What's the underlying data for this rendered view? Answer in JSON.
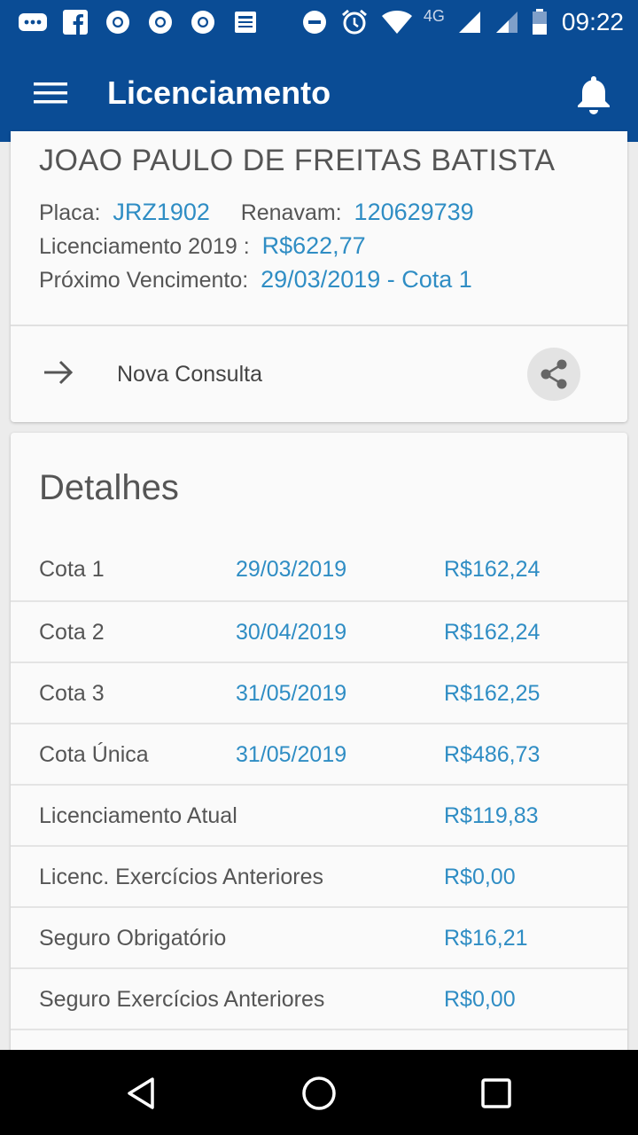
{
  "status_bar": {
    "time": "09:22",
    "network_type": "4G",
    "icons": [
      "message-icon",
      "facebook-icon",
      "chrome-icon",
      "chrome-icon",
      "chrome-icon",
      "news-icon",
      "do-not-disturb-icon",
      "alarm-icon",
      "wifi-icon",
      "signal-icon",
      "signal-icon",
      "battery-icon"
    ]
  },
  "app_bar": {
    "title": "Licenciamento",
    "menu_icon": "menu-icon",
    "notification_icon": "bell-icon"
  },
  "vehicle": {
    "owner": "JOAO PAULO DE FREITAS BATISTA",
    "placa_label": "Placa:",
    "placa": "JRZ1902",
    "renavam_label": "Renavam:",
    "renavam": "120629739",
    "licenciamento_label": "Licenciamento 2019 :",
    "licenciamento_value": "R$622,77",
    "proximo_label": "Próximo Vencimento:",
    "proximo_value": "29/03/2019 - Cota 1"
  },
  "actions": {
    "nova_consulta": "Nova Consulta",
    "arrow_icon": "arrow-right-icon",
    "share_icon": "share-icon"
  },
  "details": {
    "title": "Detalhes",
    "rows": [
      {
        "label": "Cota 1",
        "date": "29/03/2019",
        "value": "R$162,24"
      },
      {
        "label": "Cota 2",
        "date": "30/04/2019",
        "value": "R$162,24"
      },
      {
        "label": "Cota 3",
        "date": "31/05/2019",
        "value": "R$162,25"
      },
      {
        "label": "Cota Única",
        "date": "31/05/2019",
        "value": "R$486,73"
      },
      {
        "label": "Licenciamento Atual",
        "date": "",
        "value": "R$119,83"
      },
      {
        "label": "Licenc. Exercícios Anteriores",
        "date": "",
        "value": "R$0,00"
      },
      {
        "label": "Seguro Obrigatório",
        "date": "",
        "value": "R$16,21"
      },
      {
        "label": "Seguro Exercícios Anteriores",
        "date": "",
        "value": "R$0,00"
      }
    ]
  },
  "colors": {
    "primary": "#0a4c95",
    "accent_text": "#2f8dc4",
    "body_text": "#555555"
  },
  "nav_bar": {
    "icons": [
      "back-icon",
      "home-icon",
      "recents-icon"
    ]
  }
}
